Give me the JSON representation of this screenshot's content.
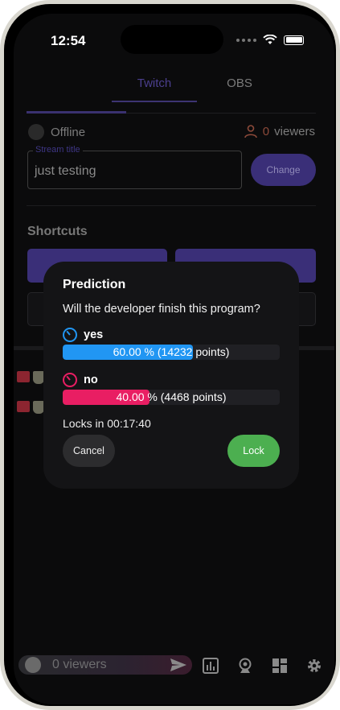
{
  "status_bar": {
    "time": "12:54"
  },
  "tabs": [
    {
      "label": "Twitch"
    },
    {
      "label": "OBS"
    }
  ],
  "stream": {
    "status": "Offline",
    "viewer_count": "0",
    "viewers_label": "viewers",
    "title_label": "Stream title",
    "title_value": "just testing",
    "change_label": "Change"
  },
  "shortcuts": {
    "title": "Shortcuts"
  },
  "bottom_bar": {
    "viewers_text": "0 viewers"
  },
  "icons": {
    "status": [
      "cellular-dots-icon",
      "wifi-icon",
      "battery-icon"
    ],
    "bottom": [
      "send-icon",
      "poll-icon",
      "camera-icon",
      "dashboard-icon",
      "settings-icon"
    ]
  },
  "prediction": {
    "title": "Prediction",
    "question": "Will the developer finish this program?",
    "outcomes": [
      {
        "label": "yes",
        "bar_text": "60.00 % (14232 points)",
        "fraction": 0.6,
        "color": "#2196f3"
      },
      {
        "label": "no",
        "bar_text": "40.00 % (4468 points)",
        "fraction": 0.4,
        "color": "#e91e63"
      }
    ],
    "locks_text": "Locks in 00:17:40",
    "cancel_label": "Cancel",
    "lock_label": "Lock"
  },
  "colors": {
    "accent": "#3a2f78",
    "lock_green": "#4caf50",
    "yes_blue": "#2196f3",
    "no_pink": "#e91e63"
  }
}
